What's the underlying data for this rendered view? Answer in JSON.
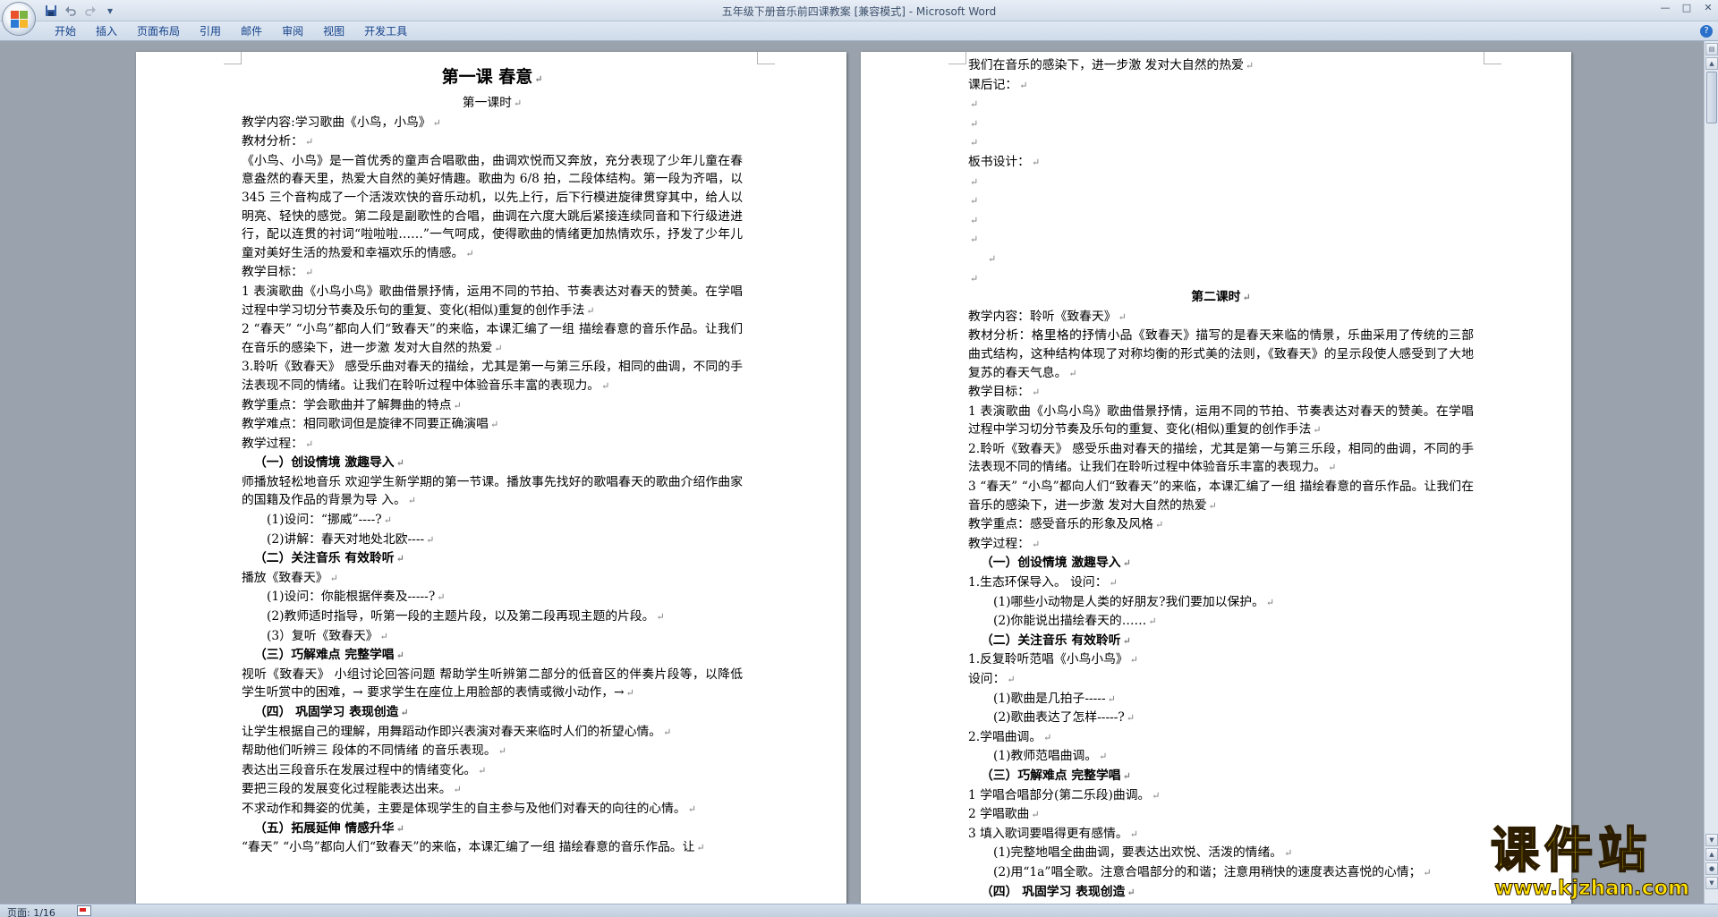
{
  "window": {
    "title": "五年级下册音乐前四课教案 [兼容模式] - Microsoft Word",
    "controls": {
      "minimize": "—",
      "maximize": "□",
      "close": "✕"
    }
  },
  "qat": {
    "save_icon": "save-icon",
    "undo_icon": "undo-icon",
    "redo_icon": "redo-icon",
    "customize": "▾"
  },
  "ribbon": {
    "tabs": [
      "开始",
      "插入",
      "页面布局",
      "引用",
      "邮件",
      "审阅",
      "视图",
      "开发工具"
    ],
    "help": "?"
  },
  "paragraph_mark": "↵",
  "page_left": {
    "title": "第一课   春意",
    "subtitle": "第一课时",
    "lines": [
      "教学内容:学习歌曲《小鸟，小鸟》",
      "教材分析：",
      "《小鸟、小鸟》是一首优秀的童声合唱歌曲，曲调欢悦而又奔放，充分表现了少年儿童在春意盎然的春天里，热爱大自然的美好情趣。歌曲为 6/8 拍，二段体结构。第一段为齐唱，以 345 三个音构成了一个活泼欢快的音乐动机，以先上行，后下行模进旋律贯穿其中，给人以明亮、轻快的感觉。第二段是副歌性的合唱，曲调在六度大跳后紧接连续同音和下行级进进行，配以连贯的衬词“啦啦啦……”一气呵成，使得歌曲的情绪更加热情欢乐，抒发了少年儿童对美好生活的热爱和幸福欢乐的情感。",
      "教学目标：",
      "1 表演歌曲《小鸟小鸟》歌曲借景抒情，运用不同的节拍、节奏表达对春天的赞美。在学唱过程中学习切分节奏及乐句的重复、变化(相似)重复的创作手法",
      "2 “春天” “小鸟”都向人们“致春天”的来临，本课汇编了一组 描绘春意的音乐作品。让我们在音乐的感染下，进一步激 发对大自然的热爱",
      "3.聆听《致春天》 感受乐曲对春天的描绘，尤其是第一与第三乐段，相同的曲调，不同的手法表现不同的情绪。让我们在聆听过程中体验音乐丰富的表现力。",
      "教学重点：学会歌曲并了解舞曲的特点",
      "教学难点：相同歌词但是旋律不同要正确演唱",
      "教学过程：",
      "（一）创设情境 激趣导入",
      "师播放轻松地音乐 欢迎学生新学期的第一节课。播放事先找好的歌唱春天的歌曲介绍作曲家的国籍及作品的背景为导 入。",
      "(1)设问：“挪威”----?",
      "(2)讲解：春天对地处北欧----",
      "（二）关注音乐  有效聆听",
      "播放《致春天》",
      "(1)设问：你能根据伴奏及-----?",
      "(2)教师适时指导，听第一段的主题片段，以及第二段再现主题的片段。",
      "(3）复听《致春天》",
      "（三）巧解难点 完整学唱",
      "视听《致春天》  小组讨论回答问题 帮助学生听辨第二部分的低音区的伴奏片段等，以降低学生听赏中的困难，→ 要求学生在座位上用脸部的表情或微小动作，→",
      "（四）  巩固学习  表现创造",
      "让学生根据自己的理解，用舞蹈动作即兴表演对春天来临时人们的祈望心情。",
      "帮助他们听辨三 段体的不同情绪 的音乐表现。",
      "表达出三段音乐在发展过程中的情绪变化。",
      "要把三段的发展变化过程能表达出来。",
      "不求动作和舞姿的优美，主要是体现学生的自主参与及他们对春天的向往的心情。",
      "（五）拓展延伸  情感升华",
      "“春天” “小鸟”都向人们“致春天”的来临，本课汇编了一组 描绘春意的音乐作品。让"
    ]
  },
  "page_right": {
    "lines_top": [
      "我们在音乐的感染下，进一步激 发对大自然的热爱",
      "课后记：",
      "",
      "",
      "",
      "板书设计：",
      "",
      "",
      "",
      "",
      "",
      ""
    ],
    "heading": "第二课时",
    "lines": [
      "教学内容：聆听《致春天》",
      "教材分析：格里格的抒情小品《致春天》描写的是春天来临的情景，乐曲采用了传统的三部曲式结构，这种结构体现了对称均衡的形式美的法则，《致春天》的呈示段使人感受到了大地复苏的春天气息。",
      "教学目标：",
      "1 表演歌曲《小鸟小鸟》歌曲借景抒情，运用不同的节拍、节奏表达对春天的赞美。在学唱过程中学习切分节奏及乐句的重复、变化(相似)重复的创作手法",
      "2.聆听《致春天》 感受乐曲对春天的描绘，尤其是第一与第三乐段，相同的曲调，不同的手法表现不同的情绪。让我们在聆听过程中体验音乐丰富的表现力。",
      "3 “春天” “小鸟”都向人们“致春天”的来临，本课汇编了一组 描绘春意的音乐作品。让我们在音乐的感染下，进一步激 发对大自然的热爱",
      "教学重点：感受音乐的形象及风格",
      "教学过程：",
      "（一）创设情境 激趣导入",
      "1.生态环保导入。     设问：",
      "(1)哪些小动物是人类的好朋友?我们要加以保护。",
      "(2)你能说出描绘春天的……",
      "（二）关注音乐  有效聆听",
      "1.反复聆听范唱《小鸟小鸟》",
      "设问：",
      "(1)歌曲是几拍子-----",
      "(2)歌曲表达了怎样-----?",
      "2.学唱曲调。",
      "(1)教师范唱曲调。",
      "（三）巧解难点 完整学唱",
      "1 学唱合唱部分(第二乐段)曲调。",
      "2 学唱歌曲",
      "3 填入歌词要唱得更有感情。",
      "(1)完整地唱全曲曲调，要表达出欢悦、活泼的情绪。",
      "(2)用“1a”唱全歌。注意合唱部分的和谐；注意用稍快的速度表达喜悦的心情；",
      "（四）  巩固学习  表现创造"
    ]
  },
  "status": {
    "page": "页面: 1/16"
  },
  "watermark": {
    "name": "课件站",
    "url": "www.kjzhan.com"
  },
  "colors": {
    "workspace": "#9aa3ad",
    "ribbon_text": "#15428b",
    "watermark": "#ffe000"
  }
}
